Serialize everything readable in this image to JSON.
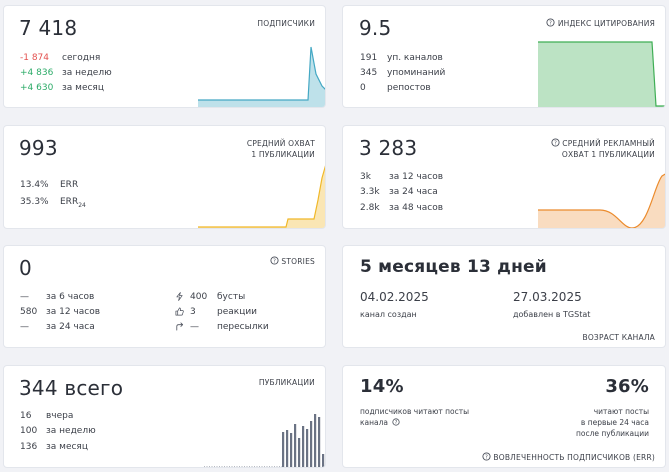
{
  "subscribers": {
    "title": "ПОДПИСЧИКИ",
    "value": "7 418",
    "rows": [
      {
        "value": "-1 874",
        "label": "сегодня",
        "tone": "red"
      },
      {
        "value": "+4 836",
        "label": "за неделю",
        "tone": "green"
      },
      {
        "value": "+4 630",
        "label": "за месяц",
        "tone": "green"
      }
    ],
    "chart_color": "#44a8c4"
  },
  "citation": {
    "title": "ИНДЕКС ЦИТИРОВАНИЯ",
    "icon": "help-circle-icon",
    "value": "9.5",
    "rows": [
      {
        "value": "191",
        "label": "уп. каналов"
      },
      {
        "value": "345",
        "label": "упоминаний"
      },
      {
        "value": "0",
        "label": "репостов"
      }
    ],
    "chart_color": "#3fae55"
  },
  "reach": {
    "title_line1": "СРЕДНИЙ ОХВАТ",
    "title_line2": "1 ПУБЛИКАЦИИ",
    "value": "993",
    "err_value": "13.4%",
    "err_label": "ERR",
    "err24_value": "35.3%",
    "err24_label": "ERR",
    "err24_sub": "24",
    "chart_color": "#f0b829"
  },
  "ad_reach": {
    "title_line1": "СРЕДНИЙ РЕКЛАМНЫЙ",
    "title_line2": "ОХВАТ 1 ПУБЛИКАЦИИ",
    "icon": "help-circle-icon",
    "value": "3 283",
    "rows": [
      {
        "value": "3k",
        "label": "за 12 часов"
      },
      {
        "value": "3.3k",
        "label": "за 24 часа"
      },
      {
        "value": "2.8k",
        "label": "за 48 часов"
      }
    ],
    "chart_color": "#eb8b2d"
  },
  "stories": {
    "title": "STORIES",
    "icon": "help-circle-icon",
    "value": "0",
    "left_rows": [
      {
        "value": "—",
        "label": "за 6 часов"
      },
      {
        "value": "580",
        "label": "за 12 часов"
      },
      {
        "value": "—",
        "label": "за 24 часа"
      }
    ],
    "right_rows": [
      {
        "icon": "lightning-icon",
        "value": "400",
        "label": "бусты"
      },
      {
        "icon": "thumbs-up-icon",
        "value": "3",
        "label": "реакции"
      },
      {
        "icon": "share-arrow-icon",
        "value": "—",
        "label": "пересылки"
      }
    ]
  },
  "age": {
    "value": "5 месяцев 13 дней",
    "created_date": "04.02.2025",
    "created_label": "канал создан",
    "added_date": "27.03.2025",
    "added_label": "добавлен в TGStat",
    "footer": "ВОЗРАСТ КАНАЛА"
  },
  "publications": {
    "title": "ПУБЛИКАЦИИ",
    "value": "344",
    "value_suffix": "всего",
    "rows": [
      {
        "value": "16",
        "label": "вчера"
      },
      {
        "value": "100",
        "label": "за неделю"
      },
      {
        "value": "136",
        "label": "за месяц"
      }
    ],
    "chart_color": "#6b7384"
  },
  "engagement": {
    "left_value": "14%",
    "left_text_line1": "подписчиков читают посты",
    "left_text_line2": "канала",
    "right_value": "36%",
    "right_text_line1": "читают посты",
    "right_text_line2": "в первые 24 часа",
    "right_text_line3": "после публикации",
    "footer": "ВОВЛЕЧЕННОСТЬ ПОДПИСЧИКОВ (ERR)",
    "icon": "help-circle-icon"
  }
}
